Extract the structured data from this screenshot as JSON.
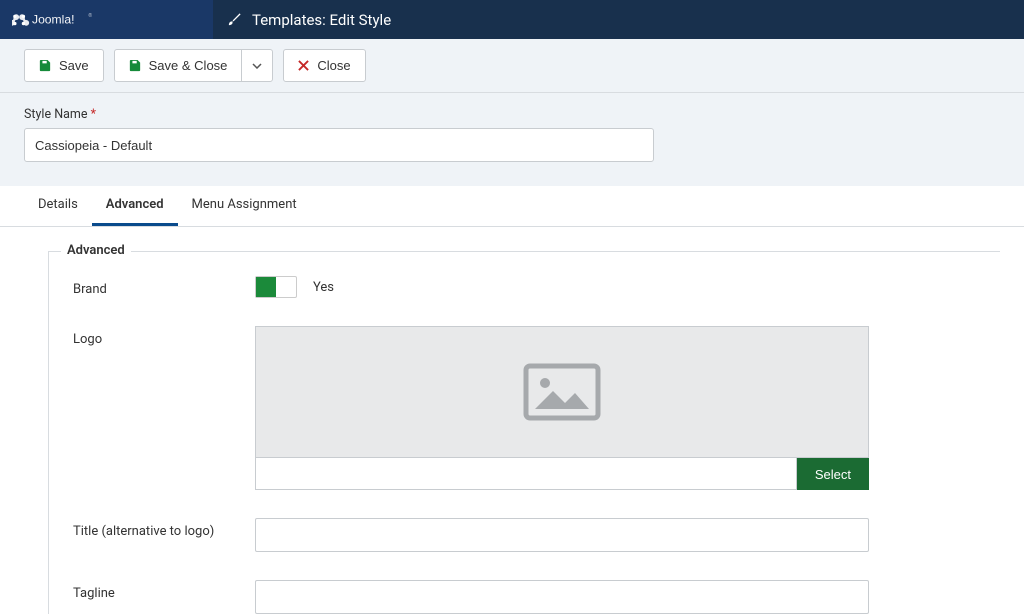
{
  "header": {
    "brand_alt": "Joomla!",
    "title": "Templates: Edit Style"
  },
  "toolbar": {
    "save_label": "Save",
    "save_close_label": "Save & Close",
    "close_label": "Close"
  },
  "form": {
    "style_name_label": "Style Name",
    "required_mark": "*",
    "style_name_value": "Cassiopeia - Default"
  },
  "tabs": [
    {
      "label": "Details",
      "active": false
    },
    {
      "label": "Advanced",
      "active": true
    },
    {
      "label": "Menu Assignment",
      "active": false
    }
  ],
  "fieldset": {
    "legend": "Advanced",
    "fields": {
      "brand": {
        "label": "Brand",
        "value": true,
        "value_text": "Yes"
      },
      "logo": {
        "label": "Logo",
        "select_label": "Select",
        "value": ""
      },
      "title": {
        "label": "Title (alternative to logo)",
        "value": ""
      },
      "tagline": {
        "label": "Tagline",
        "value": ""
      }
    }
  },
  "icons": {
    "save": "save-icon",
    "brush": "brush-icon",
    "close": "close-icon",
    "chevron_down": "chevron-down-icon",
    "image_placeholder": "image-placeholder-icon"
  }
}
